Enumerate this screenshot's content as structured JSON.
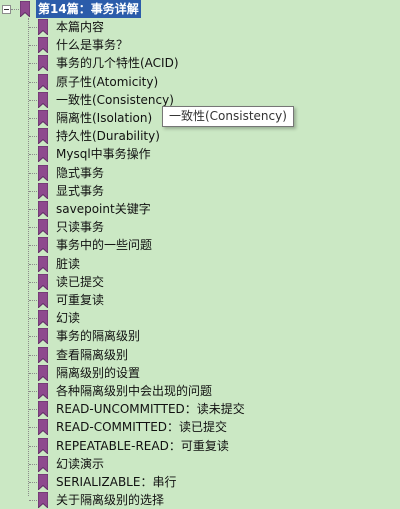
{
  "outline": {
    "root": {
      "label": "第14篇：事务详解",
      "icon": "bookmark-icon"
    },
    "children": [
      "本篇内容",
      "什么是事务？",
      "事务的几个特性(ACID)",
      "原子性(Atomicity)",
      "一致性(Consistency)",
      "隔离性(Isolation)",
      "持久性(Durability)",
      "Mysql中事务操作",
      "隐式事务",
      "显式事务",
      "savepoint关键字",
      "只读事务",
      "事务中的一些问题",
      "脏读",
      "读已提交",
      "可重复读",
      "幻读",
      "事务的隔离级别",
      "查看隔离级别",
      "隔离级别的设置",
      "各种隔离级别中会出现的问题",
      "READ-UNCOMMITTED：读未提交",
      "READ-COMMITTED：读已提交",
      "REPEATABLE-READ：可重复读",
      "幻读演示",
      "SERIALIZABLE：串行",
      "关于隔离级别的选择"
    ]
  },
  "tooltip": {
    "text": "一致性(Consistency)"
  },
  "colors": {
    "background": "#cbe8c4",
    "bookmark": "#8e4a8e",
    "bookmark_dark": "#5f2f63",
    "tree_line": "#8a8a8a"
  }
}
